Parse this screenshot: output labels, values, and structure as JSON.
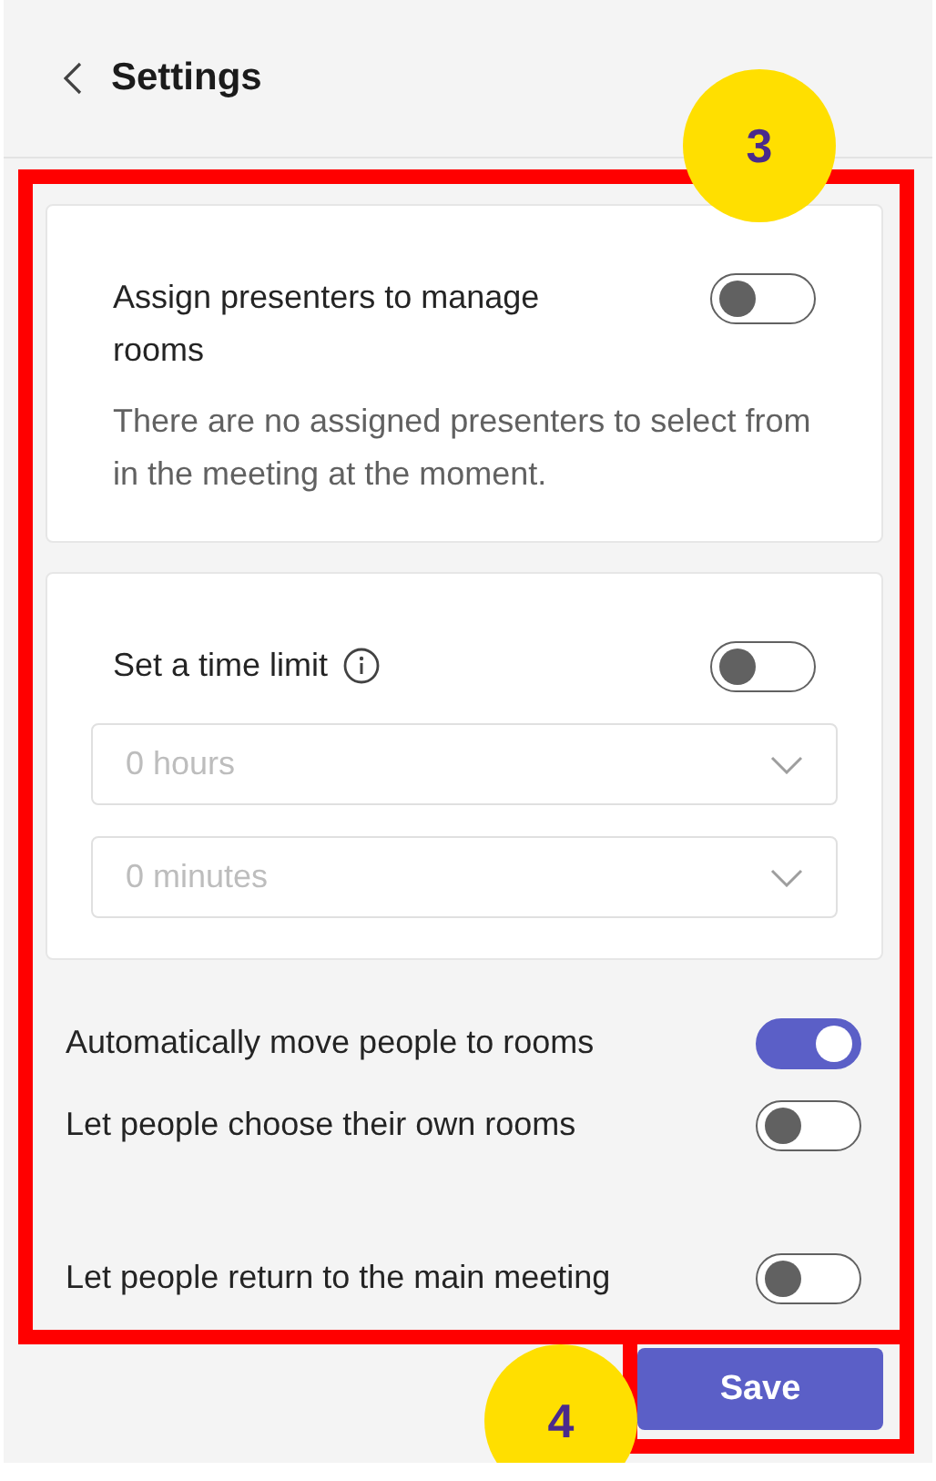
{
  "header": {
    "title": "Settings"
  },
  "cards": [
    {
      "label": "Assign presenters to manage rooms",
      "on": false,
      "description": "There are no assigned presenters to select from in the meeting at the moment."
    },
    {
      "label": "Set a time limit",
      "on": false,
      "info": true,
      "dropdowns": [
        {
          "placeholder": "0 hours"
        },
        {
          "placeholder": "0 minutes"
        }
      ]
    }
  ],
  "options": [
    {
      "label": "Automatically move people to rooms",
      "on": true
    },
    {
      "label": "Let people choose their own rooms",
      "on": false
    },
    {
      "label": "Let people return to the main meeting",
      "on": false
    }
  ],
  "save_button": "Save",
  "callouts": [
    "3",
    "4"
  ]
}
